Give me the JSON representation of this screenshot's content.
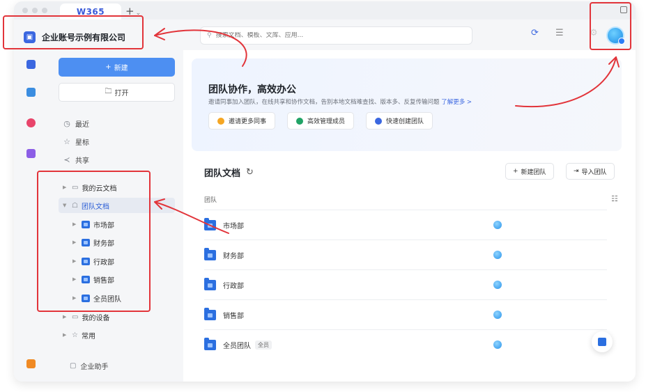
{
  "app": {
    "tab_title": "W365",
    "new_tab_symbol": "+",
    "new_tab_menu_symbol": "⌄"
  },
  "header": {
    "company_name": "企业账号示例有限公司",
    "search_placeholder": "搜索文档、模板、文库、应用..."
  },
  "sidebar": {
    "new_button": "新建",
    "open_button": "打开",
    "nav": [
      {
        "label": "最近",
        "icon": "clock-icon"
      },
      {
        "label": "星标",
        "icon": "star-icon"
      },
      {
        "label": "共享",
        "icon": "share-icon"
      }
    ],
    "tree": {
      "my_cloud": "我的云文档",
      "team_docs": "团队文档",
      "teams": [
        "市场部",
        "财务部",
        "行政部",
        "销售部",
        "全员团队"
      ],
      "my_devices": "我的设备",
      "common": "常用"
    },
    "assistant": "企业助手"
  },
  "banner": {
    "title": "团队协作，高效办公",
    "desc": "邀请同事加入团队，在线共享和协作文档，告别本地文档难查找、版本多、反复传输问题 ",
    "link": "了解更多 >",
    "buttons": [
      {
        "label": "邀请更多同事",
        "color": "#f5a623"
      },
      {
        "label": "高效管理成员",
        "color": "#21a366"
      },
      {
        "label": "快速创建团队",
        "color": "#3b67e0"
      }
    ]
  },
  "team_docs": {
    "title": "团队文档",
    "new_team_button": "新建团队",
    "import_team_button": "导入团队",
    "column_header": "团队",
    "rows": [
      {
        "name": "市场部",
        "tag": ""
      },
      {
        "name": "财务部",
        "tag": ""
      },
      {
        "name": "行政部",
        "tag": ""
      },
      {
        "name": "销售部",
        "tag": ""
      },
      {
        "name": "全员团队",
        "tag": "全员"
      }
    ]
  },
  "colors": {
    "accent": "#4d8ff2",
    "annotation": "#e2343a",
    "folder": "#2b6fe0"
  }
}
